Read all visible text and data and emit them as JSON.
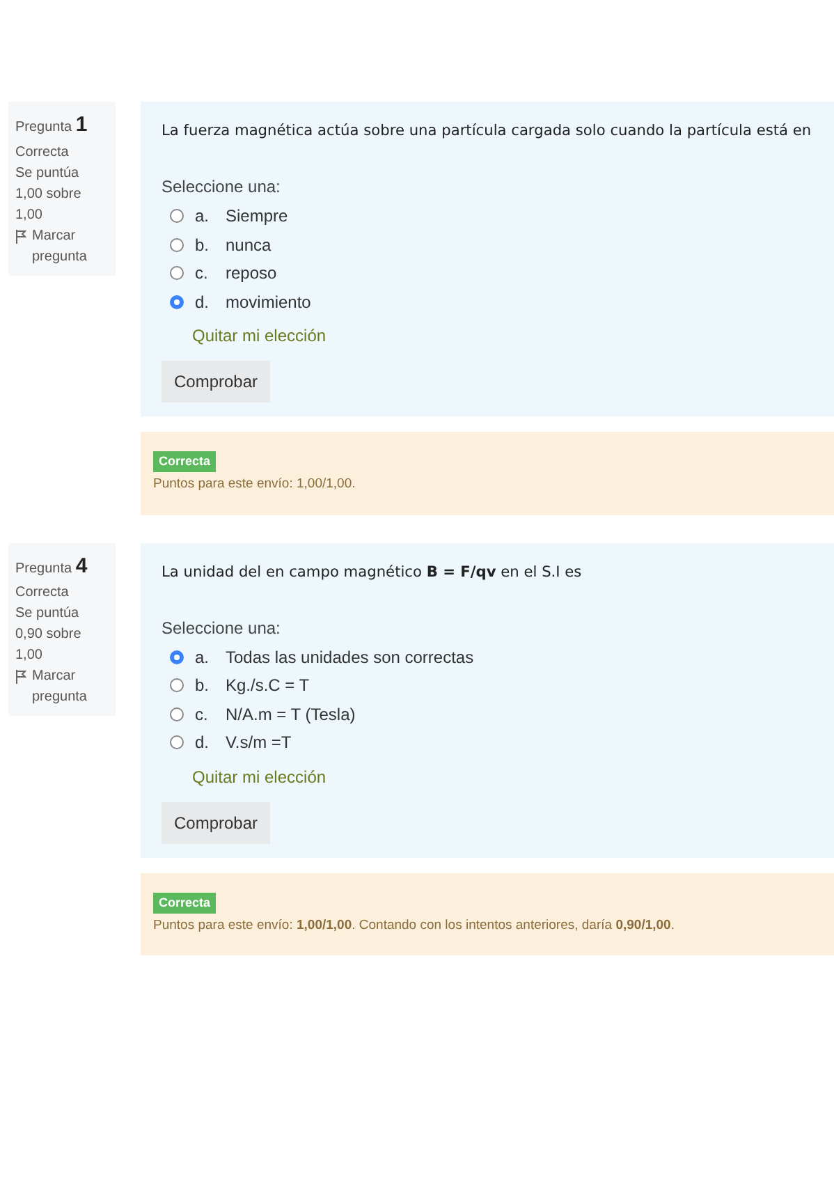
{
  "questions": [
    {
      "label": "Pregunta",
      "number": "1",
      "state": "Correcta",
      "grade": "Se puntúa 1,00 sobre 1,00",
      "flag": "Marcar pregunta",
      "text": "La fuerza magnética actúa sobre una partícula cargada solo cuando la partícula está en",
      "prompt": "Seleccione una:",
      "options": [
        {
          "letter": "a.",
          "text": "Siempre",
          "selected": false
        },
        {
          "letter": "b.",
          "text": "nunca",
          "selected": false
        },
        {
          "letter": "c.",
          "text": "reposo",
          "selected": false
        },
        {
          "letter": "d.",
          "text": "movimiento",
          "selected": true
        }
      ],
      "clear": "Quitar mi elección",
      "check": "Comprobar",
      "badge": "Correcta",
      "feedback": "Puntos para este envío: 1,00/1,00."
    },
    {
      "label": "Pregunta",
      "number": "4",
      "state": "Correcta",
      "grade": "Se puntúa 0,90 sobre 1,00",
      "flag": "Marcar pregunta",
      "text": "La unidad del en campo magnético **B = F/qv** en el S.I es",
      "prompt": "Seleccione una:",
      "options": [
        {
          "letter": "a.",
          "text": "Todas las unidades son correctas",
          "selected": true
        },
        {
          "letter": "b.",
          "text": "Kg./s.C = T",
          "selected": false
        },
        {
          "letter": "c.",
          "text": "N/A.m = T (Tesla)",
          "selected": false
        },
        {
          "letter": "d.",
          "text": "V.s/m =T",
          "selected": false
        }
      ],
      "clear": "Quitar mi elección",
      "check": "Comprobar",
      "badge": "Correcta",
      "feedback": "Puntos para este envío: **1,00/1,00**. Contando con los intentos anteriores, daría **0,90/1,00**."
    }
  ]
}
